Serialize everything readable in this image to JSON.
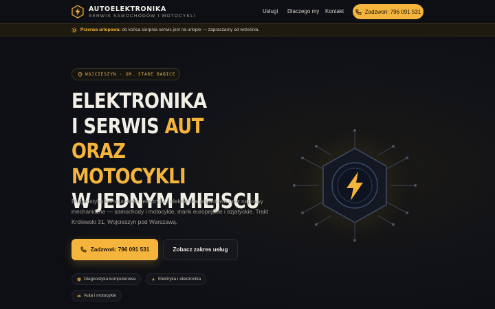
{
  "header": {
    "brand_name": "AUTOELEKTRONIKA",
    "brand_sub": "SERWIS SAMOCHODÓW I MOTOCYKLI",
    "nav": [
      "Usługi",
      "Dlaczego my",
      "Kontakt"
    ],
    "call_label": "Zadzwoń: 796 091 531"
  },
  "banner": {
    "bold": "Przerwa urlopowa:",
    "text": " do końca sierpnia serwis jest na urlopie — zapraszamy od września."
  },
  "hero": {
    "location": "WOJCIESZYN · GM. STARE BABICE",
    "headline_1": "ELEKTRONIKA",
    "headline_2a": "I SERWIS ",
    "headline_2b": "AUT ORAZ",
    "headline_3": "MOTOCYKLI",
    "headline_4": "W JEDNYM MIEJSCU",
    "lead": "Diagnostyka komputerowa, elektryka i elektronika pojazdowa oraz naprawy mechaniczne — samochody i motocykle, marki europejskie i azjatyckie. Trakt Królewski 31, Wojcieszyn pod Warszawą.",
    "primary_button": "Zadzwoń: 796 091 531",
    "secondary_button": "Zobacz zakres usług",
    "chips": [
      "Diagnostyka komputerowa",
      "Elektryka i elektronika",
      "Auta i motocykle"
    ]
  },
  "colors": {
    "accent": "#f5b43c",
    "background": "#0d0f14",
    "banner": "#1f1a10"
  },
  "icons": [
    "bolt-icon",
    "phone-icon",
    "sun-icon",
    "map-pin-icon",
    "shield-icon",
    "car-icon"
  ]
}
